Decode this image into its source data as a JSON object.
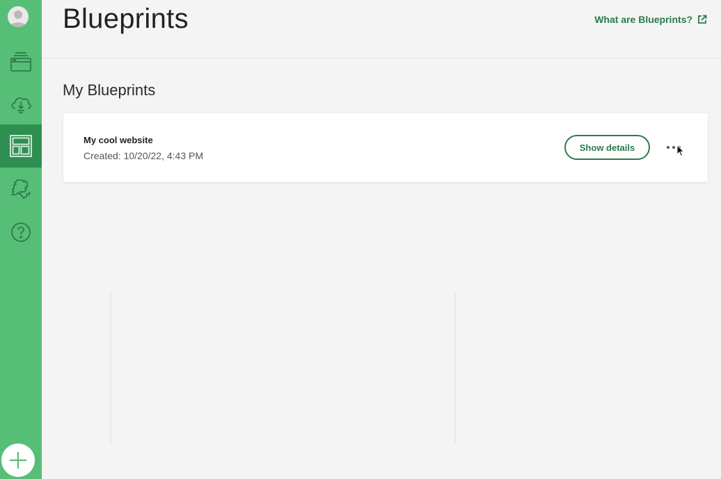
{
  "header": {
    "title": "Blueprints",
    "help_link": "What are Blueprints?"
  },
  "main": {
    "section_title": "My Blueprints",
    "blueprints": [
      {
        "name": "My cool website",
        "created": "Created: 10/20/22, 4:43 PM",
        "show_details_label": "Show details"
      }
    ]
  },
  "sidebar": {
    "items": [
      {
        "icon": "sites-icon"
      },
      {
        "icon": "cloud-download-icon"
      },
      {
        "icon": "blueprints-icon",
        "active": true
      },
      {
        "icon": "puzzle-icon"
      },
      {
        "icon": "help-icon"
      }
    ]
  },
  "colors": {
    "sidebar": "#56be77",
    "sidebar_active": "#2f8f53",
    "accent": "#2b7a4b",
    "background": "#f4f4f4"
  }
}
